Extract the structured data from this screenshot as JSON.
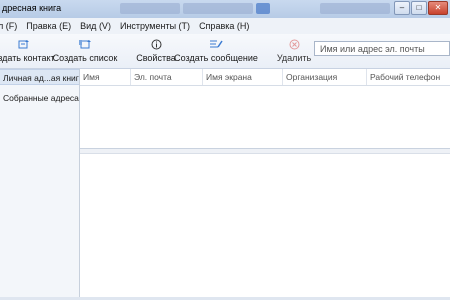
{
  "window": {
    "title": "дресная книга",
    "controls": [
      "minimize",
      "maximize",
      "close"
    ]
  },
  "menu": [
    {
      "label": "л (F)"
    },
    {
      "label": "Правка (E)"
    },
    {
      "label": "Вид (V)"
    },
    {
      "label": "Инструменты (T)"
    },
    {
      "label": "Справка (H)"
    }
  ],
  "toolbar": {
    "buttons": [
      {
        "label": "оздать контакт",
        "icon": "new-contact-icon"
      },
      {
        "label": "Создать список",
        "icon": "new-list-icon"
      },
      {
        "label": "Свойства",
        "icon": "properties-icon"
      },
      {
        "label": "Создать сообщение",
        "icon": "compose-icon"
      },
      {
        "label": "Удалить",
        "icon": "delete-icon"
      }
    ],
    "search_placeholder": "Имя или адрес эл. почты"
  },
  "sidebar": {
    "items": [
      {
        "label": "Личная ад...ая книга",
        "selected": true
      },
      {
        "label": "Собранные адреса",
        "selected": false
      }
    ]
  },
  "table": {
    "columns": [
      "Имя",
      "Эл. почта",
      "Имя экрана",
      "Организация",
      "Рабочий телефон"
    ]
  }
}
